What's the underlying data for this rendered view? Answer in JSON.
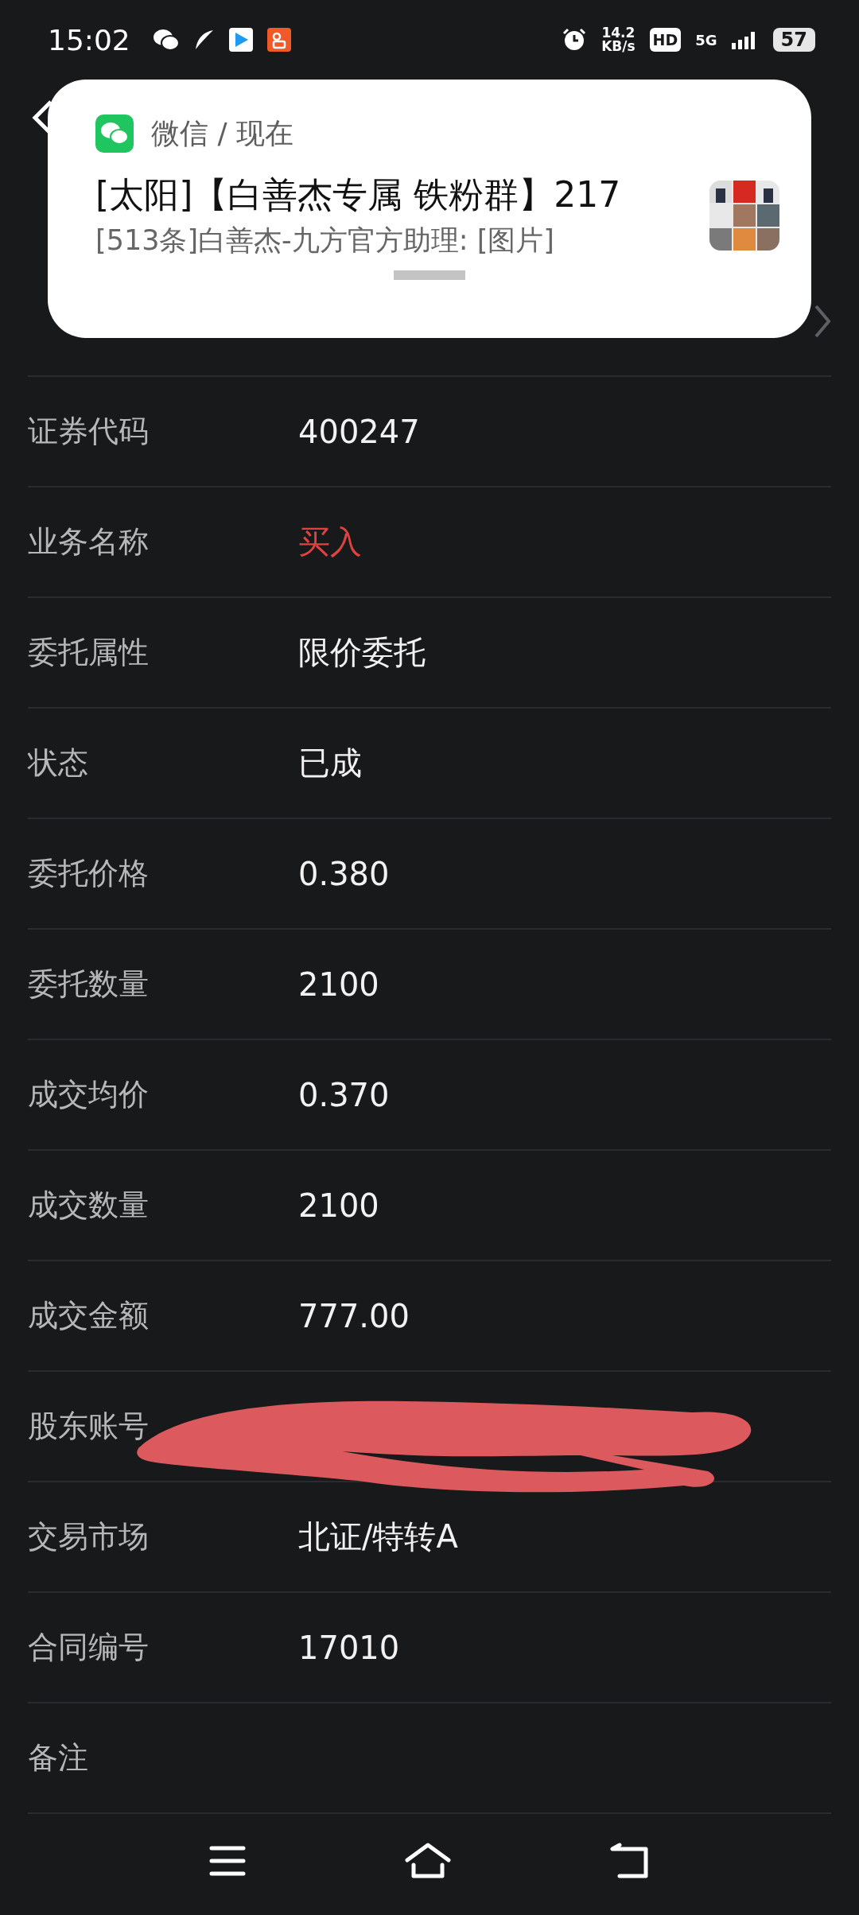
{
  "status_bar": {
    "time": "15:02",
    "net_speed": "14.2",
    "net_unit": "KB/s",
    "hd": "HD",
    "network": "5G",
    "battery": "57"
  },
  "notification": {
    "app": "微信 / 现在",
    "title": "[太阳]【白善杰专属 铁粉群】217",
    "message": "[513条]白善杰-九方官方助理: [图片]"
  },
  "rows": [
    {
      "kind": "link"
    },
    {
      "label": "证券代码",
      "value": "400247",
      "kind": "plain"
    },
    {
      "label": "业务名称",
      "value": "买入",
      "kind": "buy"
    },
    {
      "label": "委托属性",
      "value": "限价委托",
      "kind": "plain"
    },
    {
      "label": "状态",
      "value": "已成",
      "kind": "plain"
    },
    {
      "label": "委托价格",
      "value": "0.380",
      "kind": "plain"
    },
    {
      "label": "委托数量",
      "value": "2100",
      "kind": "plain"
    },
    {
      "label": "成交均价",
      "value": "0.370",
      "kind": "plain"
    },
    {
      "label": "成交数量",
      "value": "2100",
      "kind": "plain"
    },
    {
      "label": "成交金额",
      "value": "777.00",
      "kind": "plain"
    },
    {
      "label": "股东账号",
      "kind": "redacted"
    },
    {
      "label": "交易市场",
      "value": "北证/特转A",
      "kind": "plain"
    },
    {
      "label": "合同编号",
      "value": "17010",
      "kind": "plain"
    },
    {
      "label": "备注",
      "kind": "plain"
    }
  ]
}
